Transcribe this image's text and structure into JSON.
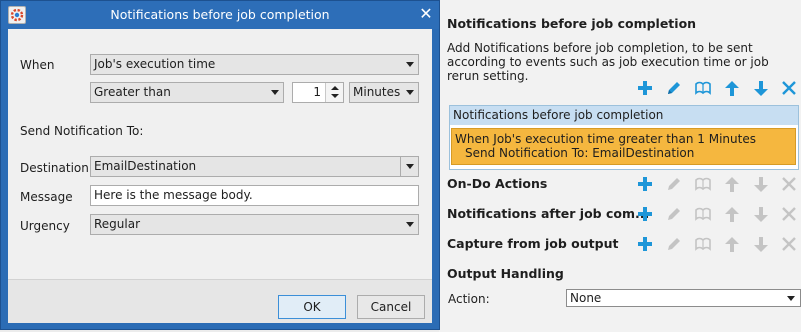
{
  "right_panel": {
    "title": "Notifications before job completion",
    "description": "Add Notifications before job completion, to be sent according to events such as job execution time or job rerun setting.",
    "list_header": "Notifications before job completion",
    "list_item_line1": "When Job's execution time greater than 1 Minutes",
    "list_item_line2": "Send Notification To: EmailDestination",
    "sections": [
      {
        "label": "On-Do Actions"
      },
      {
        "label": "Notifications after job com..."
      },
      {
        "label": "Capture from job output"
      }
    ],
    "output_handling_title": "Output Handling",
    "action_label": "Action:",
    "action_value": "None",
    "accent_color": "#1e96d8",
    "disabled_color": "#b4b4b4"
  },
  "dialog": {
    "title": "Notifications before job completion",
    "when_label": "When",
    "when_value": "Job's execution time",
    "condition_value": "Greater than",
    "amount_value": "1",
    "unit_value": "Minutes",
    "send_to_label": "Send Notification To:",
    "destination_label": "Destination",
    "destination_value": "EmailDestination",
    "message_label": "Message",
    "message_value": "Here is the message body.",
    "urgency_label": "Urgency",
    "urgency_value": "Regular",
    "ok_label": "OK",
    "cancel_label": "Cancel",
    "close_glyph": "✕"
  }
}
